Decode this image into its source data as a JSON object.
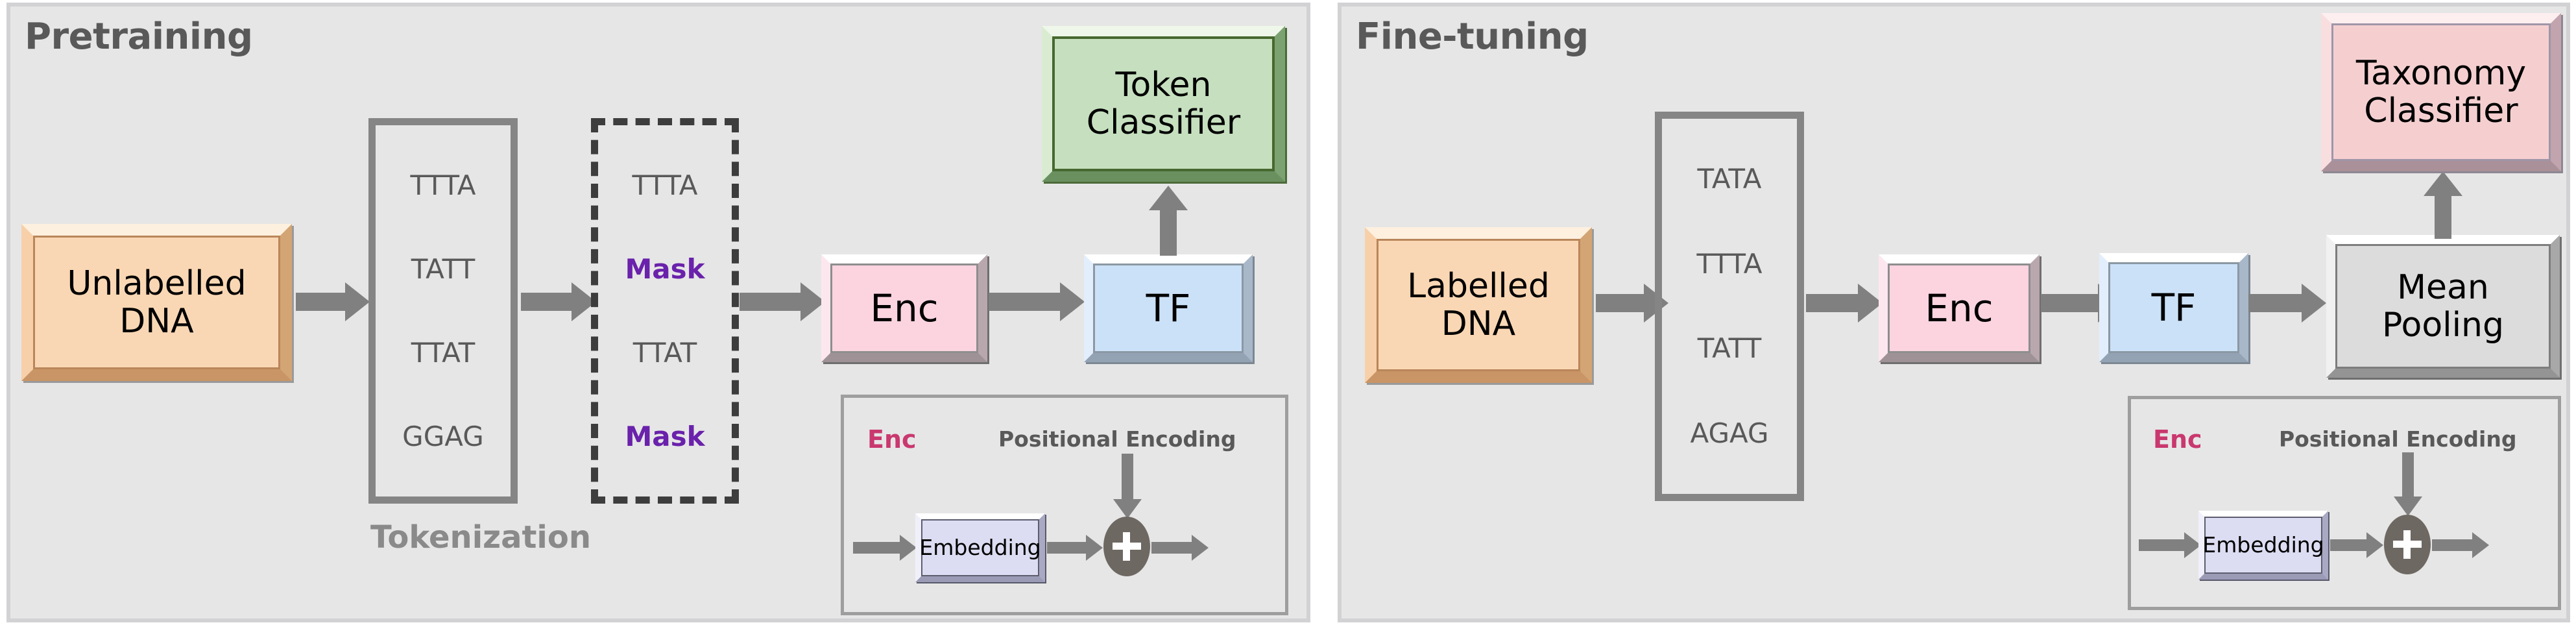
{
  "panels": {
    "pretraining": {
      "title": "Pretraining",
      "dna_box": "Unlabelled\nDNA",
      "tokenization_caption": "Tokenization",
      "tokens": [
        "TTTA",
        "TATT",
        "TTAT",
        "GGAG"
      ],
      "masked_tokens": [
        {
          "text": "TTTA",
          "masked": false
        },
        {
          "text": "Mask",
          "masked": true
        },
        {
          "text": "TTAT",
          "masked": false
        },
        {
          "text": "Mask",
          "masked": true
        }
      ],
      "encoder": "Enc",
      "transformer": "TF",
      "head": "Token\nClassifier",
      "inset": {
        "enc_label": "Enc",
        "positional_encoding_label": "Positional Encoding",
        "embedding_label": "Embedding",
        "add_symbol": "+"
      }
    },
    "finetuning": {
      "title": "Fine-tuning",
      "dna_box": "Labelled\nDNA",
      "tokens": [
        "TATA",
        "TTTA",
        "TATT",
        "AGAG"
      ],
      "encoder": "Enc",
      "transformer": "TF",
      "pooling": "Mean\nPooling",
      "head": "Taxonomy\nClassifier",
      "inset": {
        "enc_label": "Enc",
        "positional_encoding_label": "Positional Encoding",
        "embedding_label": "Embedding",
        "add_symbol": "+"
      }
    }
  },
  "colors": {
    "panel_background": "#e6e6e6",
    "panel_border": "#d2d2d4",
    "title_text": "#595959",
    "dna_box": "#fad7b4",
    "encoder_box": "#fbd4e0",
    "transformer_box": "#cbe1f7",
    "token_classifier_box": "#c6e0bf",
    "taxonomy_classifier_box": "#f5cfd0",
    "mean_pooling_box": "#dcdcdc",
    "embedding_box": "#dcdcf2",
    "mask_text": "#6a21ab",
    "arrow": "#808080",
    "enc_inset_label": "#c9386e",
    "token_text": "#595959"
  }
}
